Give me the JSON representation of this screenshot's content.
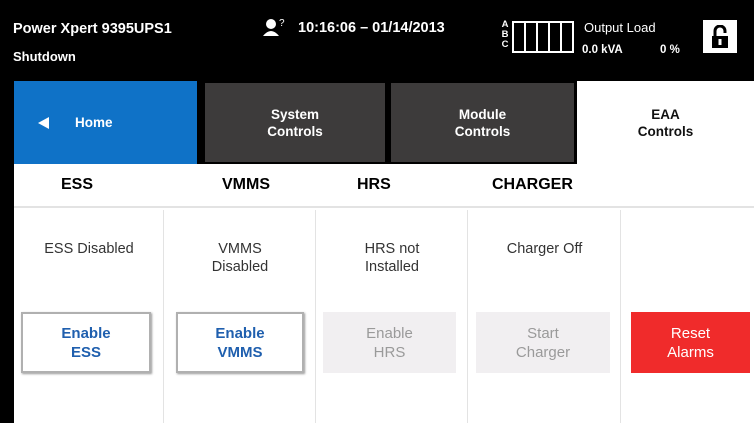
{
  "header": {
    "device_name": "Power Xpert 9395UPS1",
    "device_state": "Shutdown",
    "user_badge": "?",
    "datetime": "10:16:06 – 01/14/2013",
    "phases": [
      "A",
      "B",
      "C"
    ],
    "output_label": "Output Load",
    "output_kva": "0.0 kVA",
    "output_percent": "0 %",
    "lock_icon": "unlocked-padlock-icon"
  },
  "tabs": {
    "home": "Home",
    "system_controls": "System\nControls",
    "module_controls": "Module\nControls",
    "eaa_controls": "EAA\nControls"
  },
  "columns": {
    "ess": "ESS",
    "vmms": "VMMS",
    "hrs": "HRS",
    "charger": "CHARGER"
  },
  "status": {
    "ess": "ESS Disabled",
    "vmms": "VMMS\nDisabled",
    "hrs": "HRS not\nInstalled",
    "charger": "Charger Off"
  },
  "buttons": {
    "enable_ess": "Enable\nESS",
    "enable_vmms": "Enable\nVMMS",
    "enable_hrs": "Enable\nHRS",
    "start_charger": "Start\nCharger",
    "reset_alarms": "Reset\nAlarms"
  },
  "colors": {
    "home_tab": "#0f72c7",
    "inactive_tab": "#3d3b3b",
    "enabled_text": "#1f5fae",
    "reset_button": "#f02b2b",
    "disabled_button": "#f1eff1"
  }
}
